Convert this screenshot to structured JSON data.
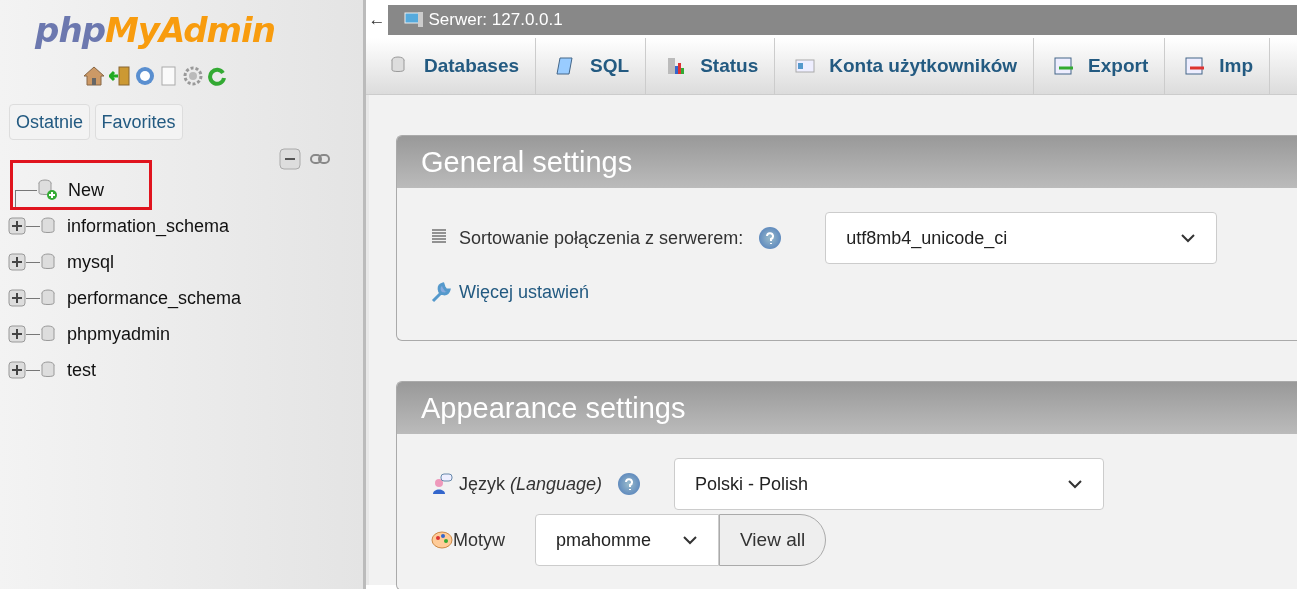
{
  "sidebar": {
    "logo": {
      "part_1": "php",
      "part_2": "MyAdmin"
    },
    "quick_buttons": [
      {
        "label": "Ostatnie"
      },
      {
        "label": "Favorites"
      }
    ],
    "tree": [
      {
        "kind": "new",
        "label": "New",
        "highlighted": true
      },
      {
        "kind": "database",
        "label": "information_schema",
        "highlighted": false
      },
      {
        "kind": "database",
        "label": "mysql",
        "highlighted": false
      },
      {
        "kind": "database",
        "label": "performance_schema",
        "highlighted": false
      },
      {
        "kind": "database",
        "label": "phpmyadmin",
        "highlighted": false
      },
      {
        "kind": "database",
        "label": "test",
        "highlighted": false
      }
    ]
  },
  "server_bar": {
    "back": "←",
    "title": "Serwer: 127.0.0.1"
  },
  "tabs": [
    {
      "kind": "databases",
      "label": "Databases"
    },
    {
      "kind": "sql",
      "label": "SQL"
    },
    {
      "kind": "status",
      "label": "Status"
    },
    {
      "kind": "users",
      "label": "Konta użytkowników"
    },
    {
      "kind": "export",
      "label": "Export"
    },
    {
      "kind": "import",
      "label": "Imp"
    }
  ],
  "panels": [
    {
      "title": "General settings",
      "rows": [
        {
          "kind": "select",
          "label": "Sortowanie połączenia z serwerem:",
          "value": "utf8mb4_unicode_ci"
        },
        {
          "kind": "link",
          "label": "Więcej ustawień"
        }
      ]
    },
    {
      "title": "Appearance settings",
      "rows": [
        {
          "kind": "select",
          "label": "Język *(Language)*",
          "value": "Polski - Polish"
        },
        {
          "kind": "theme",
          "label": "Motyw",
          "value": "pmahomme",
          "button": "View all"
        }
      ]
    }
  ]
}
